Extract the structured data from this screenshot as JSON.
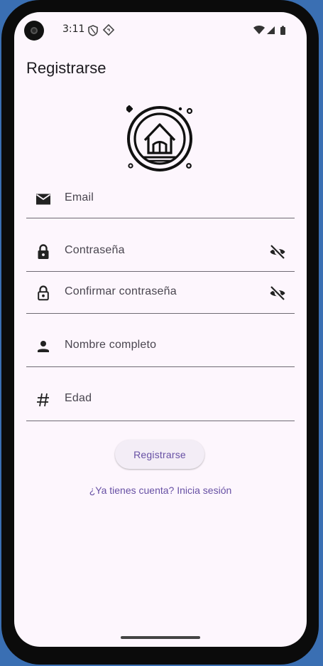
{
  "status_bar": {
    "time": "3:11"
  },
  "app_bar": {
    "title": "Registrarse"
  },
  "form": {
    "email": {
      "placeholder": "Email"
    },
    "password": {
      "placeholder": "Contraseña"
    },
    "confirm_password": {
      "placeholder": "Confirmar contraseña"
    },
    "full_name": {
      "placeholder": "Nombre completo"
    },
    "age": {
      "placeholder": "Edad"
    }
  },
  "actions": {
    "register_label": "Registrarse",
    "login_link": "¿Ya tienes cuenta? Inicia sesión"
  },
  "colors": {
    "background": "#fdf6fd",
    "accent": "#6750a4",
    "text": "#1d1b20",
    "underline": "#6f6a73"
  },
  "icons": [
    "email-icon",
    "lock-icon",
    "lock-outline-icon",
    "person-icon",
    "hash-icon",
    "visibility-off-icon",
    "house-logo-icon"
  ]
}
